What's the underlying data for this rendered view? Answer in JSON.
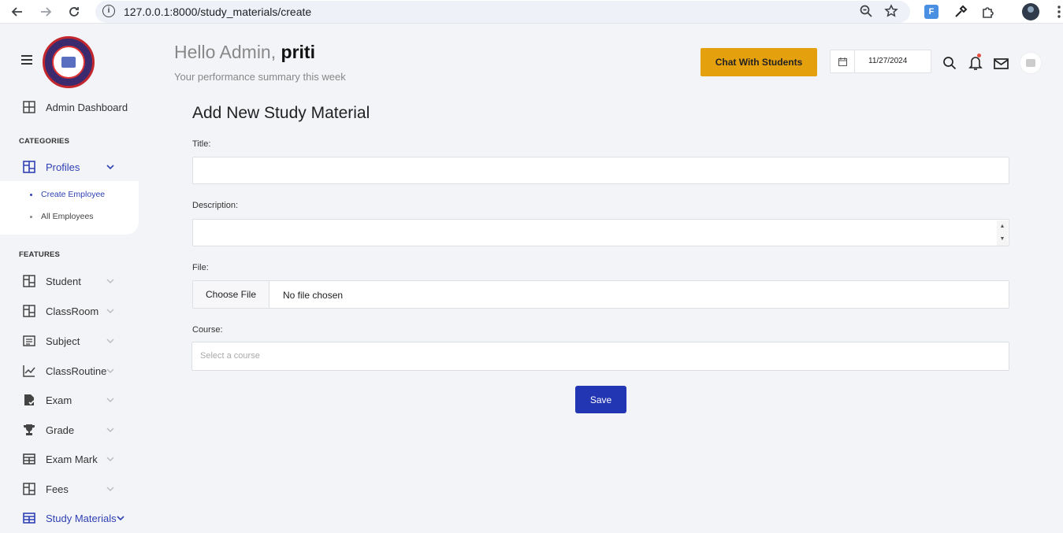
{
  "browser": {
    "url": "127.0.0.1:8000/study_materials/create",
    "extension_label": "F"
  },
  "header": {
    "greeting_prefix": "Hello Admin,",
    "greeting_name": "priti",
    "subtitle": "Your performance summary this week",
    "chat_button": "Chat With Students",
    "date": "11/27/2024"
  },
  "sidebar": {
    "dashboard": "Admin Dashboard",
    "categories_heading": "CATEGORIES",
    "profiles": "Profiles",
    "profile_items": [
      "Create Employee",
      "All Employees"
    ],
    "features_heading": "FEATURES",
    "features": [
      "Student",
      "ClassRoom",
      "Subject",
      "ClassRoutine",
      "Exam",
      "Grade",
      "Exam Mark",
      "Fees",
      "Study Materials"
    ]
  },
  "form": {
    "title": "Add New Study Material",
    "title_label": "Title:",
    "description_label": "Description:",
    "file_label": "File:",
    "choose_file": "Choose File",
    "no_file": "No file chosen",
    "course_label": "Course:",
    "course_placeholder": "Select a course",
    "save": "Save"
  },
  "colors": {
    "accent": "#2236b3",
    "chat_button": "#e5a00d",
    "background": "#f3f4f7"
  }
}
